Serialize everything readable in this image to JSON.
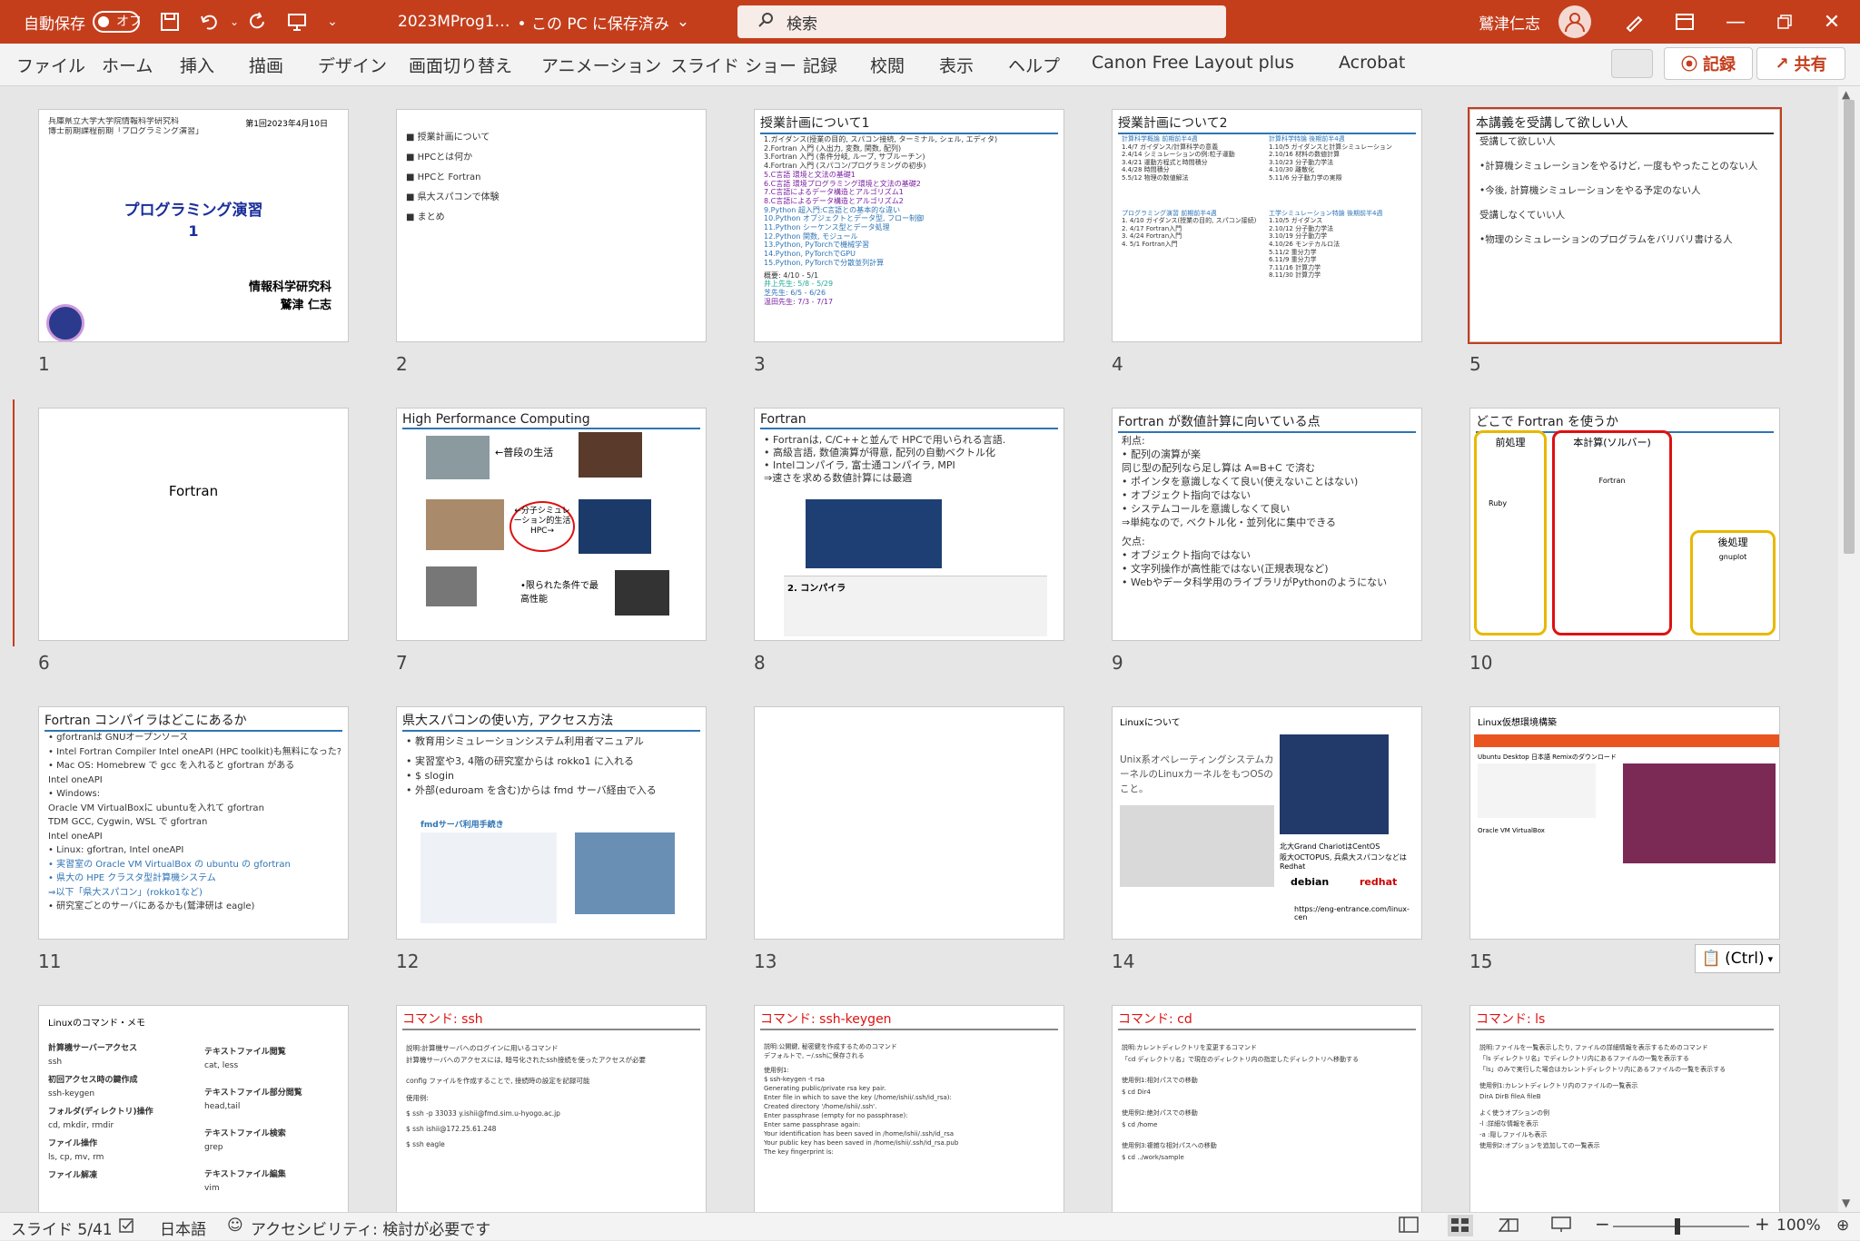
{
  "titlebar": {
    "autosave": "自動保存",
    "toggle": "オフ",
    "filename": "2023MProg1…",
    "save_state": "• この PC に保存済み",
    "search": "検索",
    "user": "鷲津仁志"
  },
  "ribbon": {
    "tabs": [
      "ファイル",
      "ホーム",
      "挿入",
      "描画",
      "デザイン",
      "画面切り替え",
      "アニメーション",
      "スライド ショー",
      "記録",
      "校閲",
      "表示",
      "ヘルプ",
      "Canon Free Layout plus",
      "Acrobat"
    ],
    "record": "記録",
    "share": "共有"
  },
  "slides": [
    {
      "n": "1",
      "lines": [
        "兵庫県立大学大学院情報科学研究科",
        "博士前期課程前期「プログラミング演習」",
        "第1回2023年4月10日",
        "プログラミング演習",
        "1",
        "情報科学研究科",
        "鷲津 仁志"
      ]
    },
    {
      "n": "2",
      "lines": [
        "授業計画について",
        "HPCとは何か",
        "HPCと Fortran",
        "県大スパコンで体験",
        "まとめ"
      ]
    },
    {
      "n": "3",
      "title": "授業計画について1",
      "lines": [
        "1.ガイダンス(授業の目的, スパコン接続, ターミナル, シェル, エディタ)",
        "2.Fortran 入門 (入出力, 変数, 関数, 配列)",
        "3.Fortran 入門 (条件分岐, ループ, サブルーチン)",
        "4.Fortran 入門 (スパコン/プログラミングの初歩)",
        "5.C言語 環境と文法の基礎1",
        "6.C言語 環境プログラミング環境と文法の基礎2",
        "7.C言語によるデータ構造とアルゴリズム1",
        "8.C言語によるデータ構造とアルゴリズム2",
        "9.Python 超入門:C言語との基本的な違い",
        "10.Python オブジェクトとデータ型, フロー制御",
        "11.Python シーケンス型とデータ処理",
        "12.Python 関数, モジュール",
        "13.Python, PyTorchで機械学習",
        "14.Python, PyTorchでGPU",
        "15.Python, PyTorchで分散並列計算",
        "概要: 4/10 - 5/1",
        "井上先生: 5/8 - 5/29",
        "芝先生: 6/5 - 6/26",
        "温田先生: 7/3 - 7/17"
      ]
    },
    {
      "n": "4",
      "title": "授業計画について2",
      "lines": [
        "計算科学概論 前期前半4週",
        "1.4/7 ガイダンス/計算科学の意義",
        "2.4/14 シミュレーションの例:粒子運動",
        "3.4/21 運動方程式と時間積分",
        "4.4/28 時間積分",
        "5.5/12 物理の数値解法",
        "計算科学特論 後期前半4週",
        "1.10/5 ガイダンスと計算シミュレーション",
        "2.10/16 材料の数値計算",
        "3.10/23 分子動力学法",
        "4.10/30 離散化",
        "5.11/6 分子動力学の実際",
        "プログラミング演習 前期前半4週",
        "1. 4/10 ガイダンス(授業の目的, スパコン接続)",
        "2. 4/17 Fortran入門",
        "3. 4/24 Fortran入門",
        "4. 5/1 Fortran入門",
        "工学シミュレーション特論 後期前半4週",
        "1.10/5 ガイダンス",
        "2.10/12 分子動力学法",
        "3.10/19 分子動力学",
        "4.10/26 モンテカルロ法",
        "5.11/2 重分力学",
        "6.11/9 重分力学",
        "7.11/16 計算力学",
        "8.11/30 計算力学"
      ]
    },
    {
      "n": "5",
      "title": "本講義を受講して欲しい人",
      "lines": [
        "受講して欲しい人",
        "•計算機シミュレーションをやるけど, 一度もやったことのない人",
        "•今後, 計算機シミュレーションをやる予定のない人",
        "受講しなくていい人",
        "•物理のシミュレーションのプログラムをバリバリ書ける人"
      ]
    },
    {
      "n": "6",
      "lines": [
        "Fortran"
      ]
    },
    {
      "n": "7",
      "title": "High Performance Computing",
      "lines": [
        "←普段の生活",
        "←分子シミュレーション的生活 HPC→",
        "•限られた条件で最高性能"
      ]
    },
    {
      "n": "8",
      "title": "Fortran",
      "lines": [
        "• Fortranは, C/C++と並んで HPCで用いられる言語.",
        "• 高級言語, 数値演算が得意, 配列の自動ベクトル化",
        "• Intelコンパイラ, 富士通コンパイラ, MPI",
        "  ⇒速さを求める数値計算には最適",
        "2. コンパイラ"
      ]
    },
    {
      "n": "9",
      "title": "Fortran が数値計算に向いている点",
      "lines": [
        "利点:",
        "• 配列の演算が楽",
        "  同じ型の配列なら足し算は A=B+C で済む",
        "• ポインタを意識しなくて良い(使えないことはない)",
        "• オブジェクト指向ではない",
        "• システムコールを意識しなくて良い",
        "  ⇒単純なので, ベクトル化・並列化に集中できる",
        "欠点:",
        "• オブジェクト指向ではない",
        "• 文字列操作が高性能ではない(正規表現など)",
        "• Webやデータ科学用のライブラリがPythonのようにない"
      ]
    },
    {
      "n": "10",
      "title": "どこで Fortran を使うか",
      "lines": [
        "前処理",
        "本計算(ソルバー)",
        "後処理",
        "Fortran",
        "Ruby",
        "gnuplot"
      ]
    },
    {
      "n": "11",
      "title": "Fortran コンパイラはどこにあるか",
      "lines": [
        "• gfortranは GNUオープンソース",
        "• Intel Fortran Compiler Intel oneAPI (HPC toolkit)も無料になった?",
        "• Mac OS: Homebrew で gcc を入れると gfortran がある",
        "  Intel oneAPI",
        "• Windows:",
        "  Oracle VM VirtualBoxに ubuntuを入れて gfortran",
        "  TDM GCC, Cygwin, WSL で gfortran",
        "  Intel oneAPI",
        "• Linux: gfortran, Intel oneAPI",
        "• 実習室の Oracle VM VirtualBox の ubuntu の gfortran",
        "• 県大の HPE クラスタ型計算機システム",
        "  ⇒以下「県大スパコン」(rokko1など)",
        "• 研究室ごとのサーバにあるかも(鷲津研は eagle)"
      ]
    },
    {
      "n": "12",
      "title": "県大スパコンの使い方, アクセス方法",
      "lines": [
        "• 教育用シミュレーションシステム利用者マニュアル",
        "• 実習室や3, 4階の研究室からは rokko1 に入れる",
        "• $ slogin",
        "• 外部(eduroam を含む)からは fmd サーバ経由で入る",
        "fmdサーバ利用手続き"
      ]
    },
    {
      "n": "13",
      "lines": []
    },
    {
      "n": "14",
      "title": "Linuxについて",
      "lines": [
        "Unix系オペレーティングシステムカーネルのLinuxカーネルをもつOSのこと。",
        "北大Grand ChariotはCentOS",
        "阪大OCTOPUS, 兵県大スパコンなどはRedhat",
        "debian",
        "redhat",
        "https://eng-entrance.com/linux-cen"
      ]
    },
    {
      "n": "15",
      "title": "Linux仮想環境構築",
      "lines": [
        "Ubuntu Desktop 日本語 Remixのダウンロード",
        "Oracle VM VirtualBox"
      ]
    },
    {
      "n": "16",
      "title": "Linuxのコマンド・メモ",
      "lines": [
        "計算機サーバーアクセス",
        "ssh",
        "初回アクセス時の鍵作成",
        "ssh-keygen",
        "フォルダ(ディレクトリ)操作",
        "cd, mkdir, rmdir",
        "ファイル操作",
        "ls, cp, mv, rm",
        "ファイル解凍",
        "テキストファイル閲覧",
        "cat, less",
        "テキストファイル部分閲覧",
        "head,tail",
        "テキストファイル検索",
        "grep",
        "テキストファイル編集",
        "vim"
      ]
    },
    {
      "n": "17",
      "title": "コマンド: ssh",
      "lines": [
        "説明:計算機サーバへのログインに用いるコマンド",
        "計算機サーバへのアクセスには, 暗号化されたssh接続を使ったアクセスが必要",
        "config ファイルを作成することで, 接続時の設定を記録可能",
        "使用例:",
        "$ ssh -p 33033 y.ishii@fmd.sim.u-hyogo.ac.jp",
        "$ ssh ishii@172.25.61.248",
        "$ ssh eagle"
      ]
    },
    {
      "n": "18",
      "title": "コマンド: ssh-keygen",
      "lines": [
        "説明:公開鍵, 秘密鍵を作成するためのコマンド",
        "デフォルトで, ~/.sshに保存される",
        "使用例1:",
        "$ ssh-keygen -t rsa",
        "Generating public/private rsa key pair.",
        "Enter file in which to save the key (/home/ishii/.ssh/id_rsa):",
        "Created directory '/home/ishii/.ssh'.",
        "Enter passphrase (empty for no passphrase):",
        "Enter same passphrase again:",
        "Your identification has been saved in /home/ishii/.ssh/id_rsa",
        "Your public key has been saved in /home/ishii/.ssh/id_rsa.pub",
        "The key fingerprint is:"
      ]
    },
    {
      "n": "19",
      "title": "コマンド: cd",
      "lines": [
        "説明:カレントディレクトリを変更するコマンド",
        "「cd ディレクトリ名」で現在のディレクトリ内の指定したディレクトリへ移動する",
        "使用例1:相対パスでの移動",
        "$ cd Dir4",
        "使用例2:絶対パスでの移動",
        "$ cd /home",
        "使用例3:複雑な相対パスへの移動",
        "$ cd ../work/sample"
      ]
    },
    {
      "n": "20",
      "title": "コマンド: ls",
      "lines": [
        "説明:ファイルを一覧表示したり, ファイルの詳細情報を表示するためのコマンド",
        "「ls ディレクトリ名」でディレクトリ内にあるファイルの一覧を表示する",
        "「ls」のみで実行した場合はカレントディレクトリ内にあるファイルの一覧を表示する",
        "使用例1:カレントディレクトリ内のファイルの一覧表示",
        "DirA DirB fileA fileB",
        "よく使うオプションの例",
        "-l :詳細な情報を表示",
        "-a :隠しファイルも表示",
        "使用例2:オプションを追加しての一覧表示"
      ]
    }
  ],
  "paste_tag": "(Ctrl)",
  "status": {
    "slide": "スライド 5/41",
    "lang": "日本語",
    "accessibility": "アクセシビリティ: 検討が必要です",
    "zoom": "100%"
  }
}
